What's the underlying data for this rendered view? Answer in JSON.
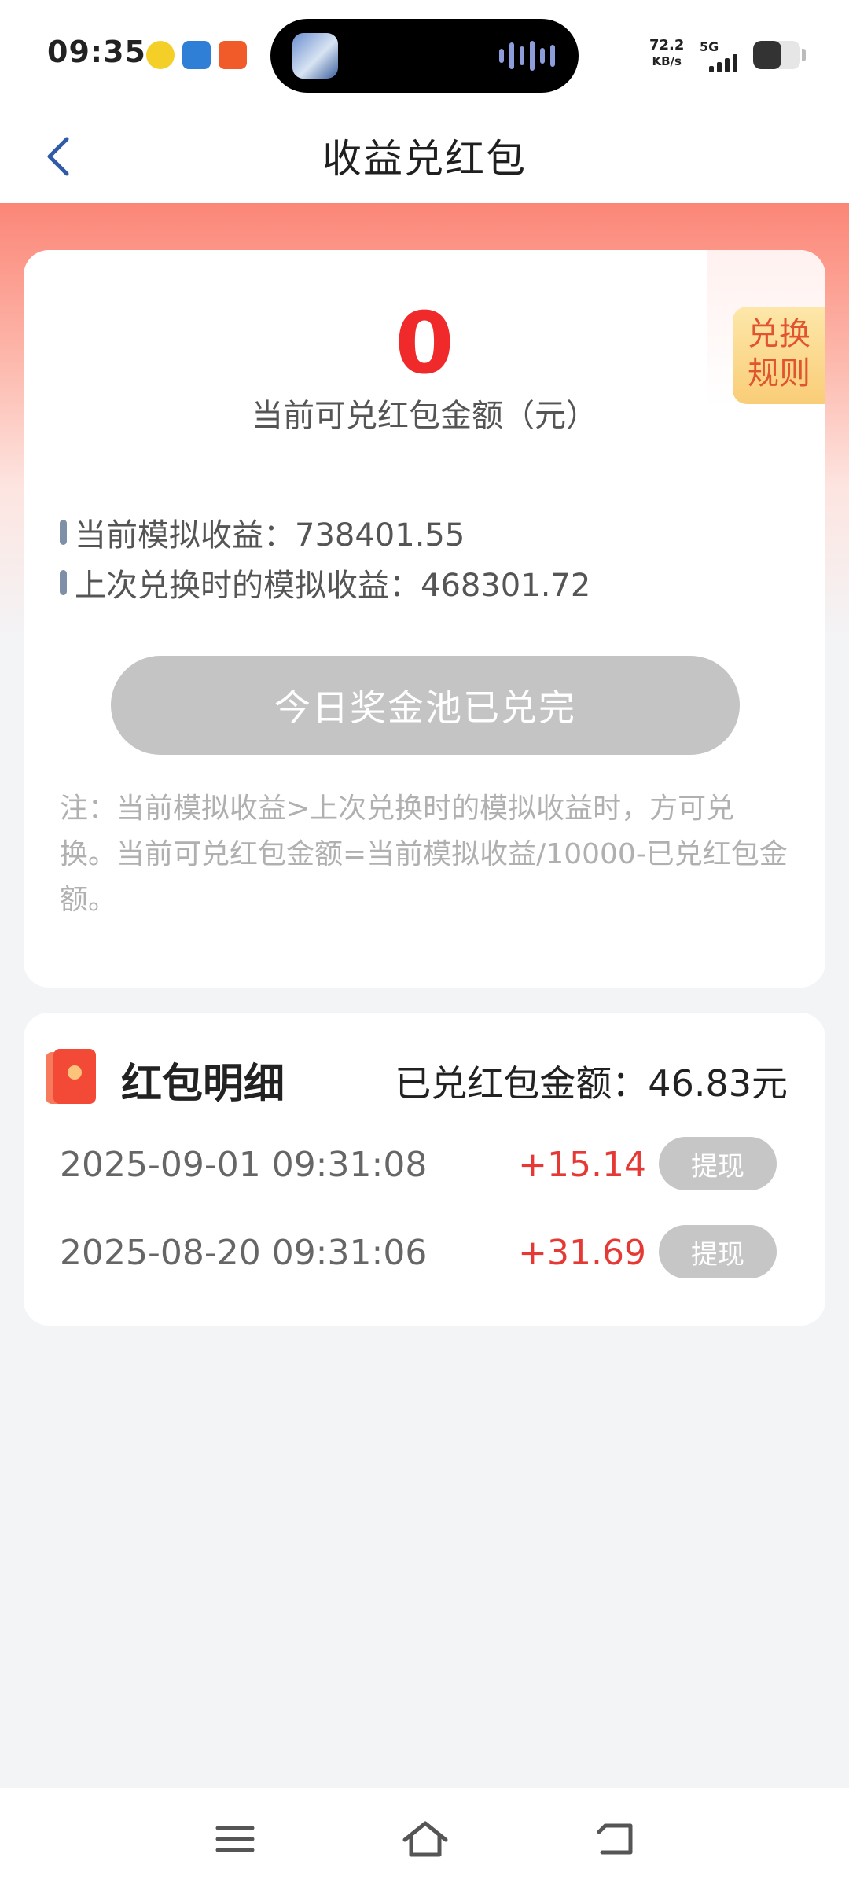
{
  "status_bar": {
    "time": "09:35",
    "net_speed_value": "72.2",
    "net_speed_unit": "KB/s",
    "network": "5G",
    "battery_percent": 60
  },
  "header": {
    "title": "收益兑红包",
    "back_icon": "chevron-left-icon"
  },
  "summary": {
    "amount": "0",
    "amount_label": "当前可兑红包金额（元）",
    "rule_tab_line1": "兑换",
    "rule_tab_line2": "规则",
    "current_sim_income": "当前模拟收益：738401.55",
    "last_exchange_income": "上次兑换时的模拟收益：468301.72",
    "exchange_button": "今日奖金池已兑完",
    "note": "注：当前模拟收益>上次兑换时的模拟收益时，方可兑换。当前可兑红包金额=当前模拟收益/10000-已兑红包金额。"
  },
  "details": {
    "title": "红包明细",
    "total": "已兑红包金额：46.83元",
    "records": [
      {
        "time": "2025-09-01 09:31:08",
        "amount": "+15.14",
        "action": "提现"
      },
      {
        "time": "2025-08-20 09:31:06",
        "amount": "+31.69",
        "action": "提现"
      }
    ]
  },
  "colors": {
    "accent_red": "#f02a2a",
    "amount_red": "#e53935",
    "disabled_gray": "#c4c4c4",
    "rule_tab_text": "#e0542f"
  }
}
